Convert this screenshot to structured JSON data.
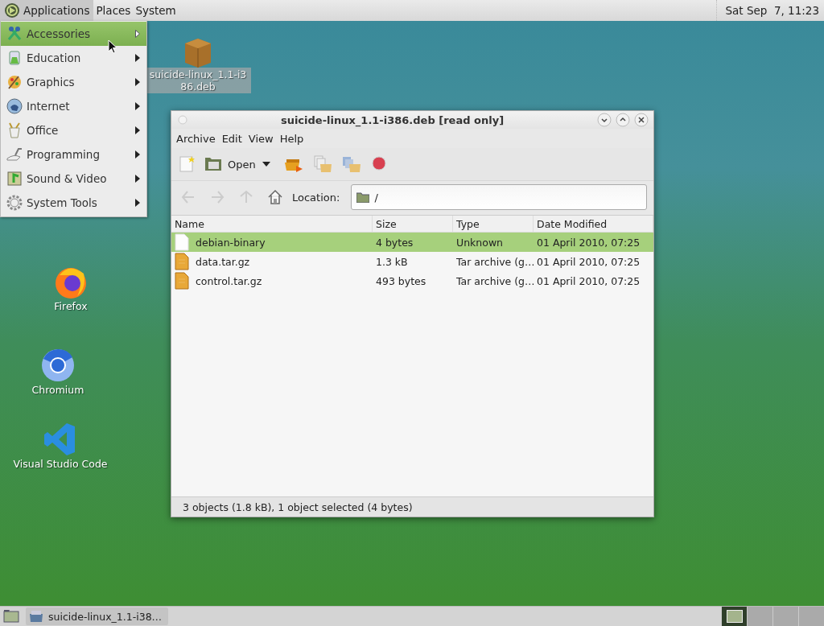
{
  "top_panel": {
    "menus": [
      {
        "label": "Applications",
        "selected": true
      },
      {
        "label": "Places",
        "selected": false
      },
      {
        "label": "System",
        "selected": false
      }
    ],
    "clock": "Sat Sep  7, 11:23"
  },
  "applications_menu": {
    "items": [
      {
        "label": "Accessories",
        "kind": "accessories",
        "selected": true
      },
      {
        "label": "Education",
        "kind": "education",
        "selected": false
      },
      {
        "label": "Graphics",
        "kind": "graphics",
        "selected": false
      },
      {
        "label": "Internet",
        "kind": "internet",
        "selected": false
      },
      {
        "label": "Office",
        "kind": "office",
        "selected": false
      },
      {
        "label": "Programming",
        "kind": "programming",
        "selected": false
      },
      {
        "label": "Sound & Video",
        "kind": "sound",
        "selected": false
      },
      {
        "label": "System Tools",
        "kind": "tools",
        "selected": false
      }
    ]
  },
  "desktop_icons": [
    {
      "label": "suicide-linux_1.1-i386.deb",
      "kind": "package",
      "selected": true
    },
    {
      "label": "Firefox",
      "kind": "firefox",
      "selected": false
    },
    {
      "label": "Chromium",
      "kind": "chromium",
      "selected": false
    },
    {
      "label": "Visual Studio Code",
      "kind": "vscode",
      "selected": false
    }
  ],
  "window": {
    "title": "suicide-linux_1.1-i386.deb [read only]",
    "menu_bar": [
      "Archive",
      "Edit",
      "View",
      "Help"
    ],
    "toolbar": [
      {
        "kind": "new"
      },
      {
        "kind": "open",
        "label": "Open"
      },
      {
        "kind": "extract"
      },
      {
        "kind": "add-files"
      },
      {
        "kind": "add-folder"
      },
      {
        "kind": "stop"
      }
    ],
    "location": {
      "label": "Location:",
      "value": "/"
    },
    "table": {
      "columns": [
        "Name",
        "Size",
        "Type",
        "Date Modified"
      ],
      "rows": [
        {
          "kind": "file",
          "cells": [
            "debian-binary",
            "4 bytes",
            "Unknown",
            "01 April 2010, 07:25"
          ],
          "selected": true
        },
        {
          "kind": "archive",
          "cells": [
            "data.tar.gz",
            "1.3 kB",
            "Tar archive (g…",
            "01 April 2010, 07:25"
          ],
          "selected": false
        },
        {
          "kind": "archive",
          "cells": [
            "control.tar.gz",
            "493 bytes",
            "Tar archive (g…",
            "01 April 2010, 07:25"
          ],
          "selected": false
        }
      ]
    },
    "status_bar": "3 objects (1.8 kB), 1 object selected (4 bytes)"
  },
  "bottom_panel": {
    "task": "suicide-linux_1.1-i38…",
    "workspaces": [
      {
        "selected": true
      },
      {
        "selected": false
      },
      {
        "selected": false
      },
      {
        "selected": false
      }
    ]
  }
}
